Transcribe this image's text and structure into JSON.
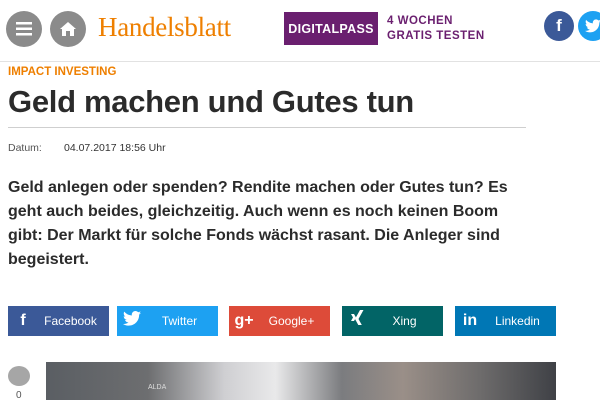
{
  "header": {
    "menu_icon": "menu-icon",
    "home_icon": "home-icon",
    "logo_text": "Handelsblatt",
    "digitalpass_label": "DIGITALPASS",
    "promo_line1": "4 WOCHEN",
    "promo_line2": "GRATIS TESTEN",
    "facebook_icon_glyph": "f",
    "colors": {
      "logo": "#ee7f00",
      "digitalpass": "#6a1f6f"
    }
  },
  "article": {
    "kicker": "IMPACT INVESTING",
    "title": "Geld machen und Gutes tun",
    "date_label": "Datum:",
    "date_value": "04.07.2017 18:56 Uhr",
    "lead": "Geld anlegen oder spenden? Rendite machen oder Gutes tun? Es geht auch beides, gleichzeitig. Auch wenn es noch keinen Boom gibt: Der Markt für solche Fonds wächst rasant. Die Anleger sind begeistert."
  },
  "share": [
    {
      "label": "Facebook",
      "icon": "f",
      "color": "#3b5998"
    },
    {
      "label": "Twitter",
      "icon": "twitter-bird",
      "color": "#1da1f2"
    },
    {
      "label": "Google+",
      "icon": "g+",
      "color": "#dd4b39"
    },
    {
      "label": "Xing",
      "icon": "xing",
      "color": "#026466"
    },
    {
      "label": "Linkedin",
      "icon": "in",
      "color": "#0077b5"
    }
  ],
  "comments": {
    "count": "0"
  },
  "photo": {
    "sign_text": "ALDA"
  }
}
